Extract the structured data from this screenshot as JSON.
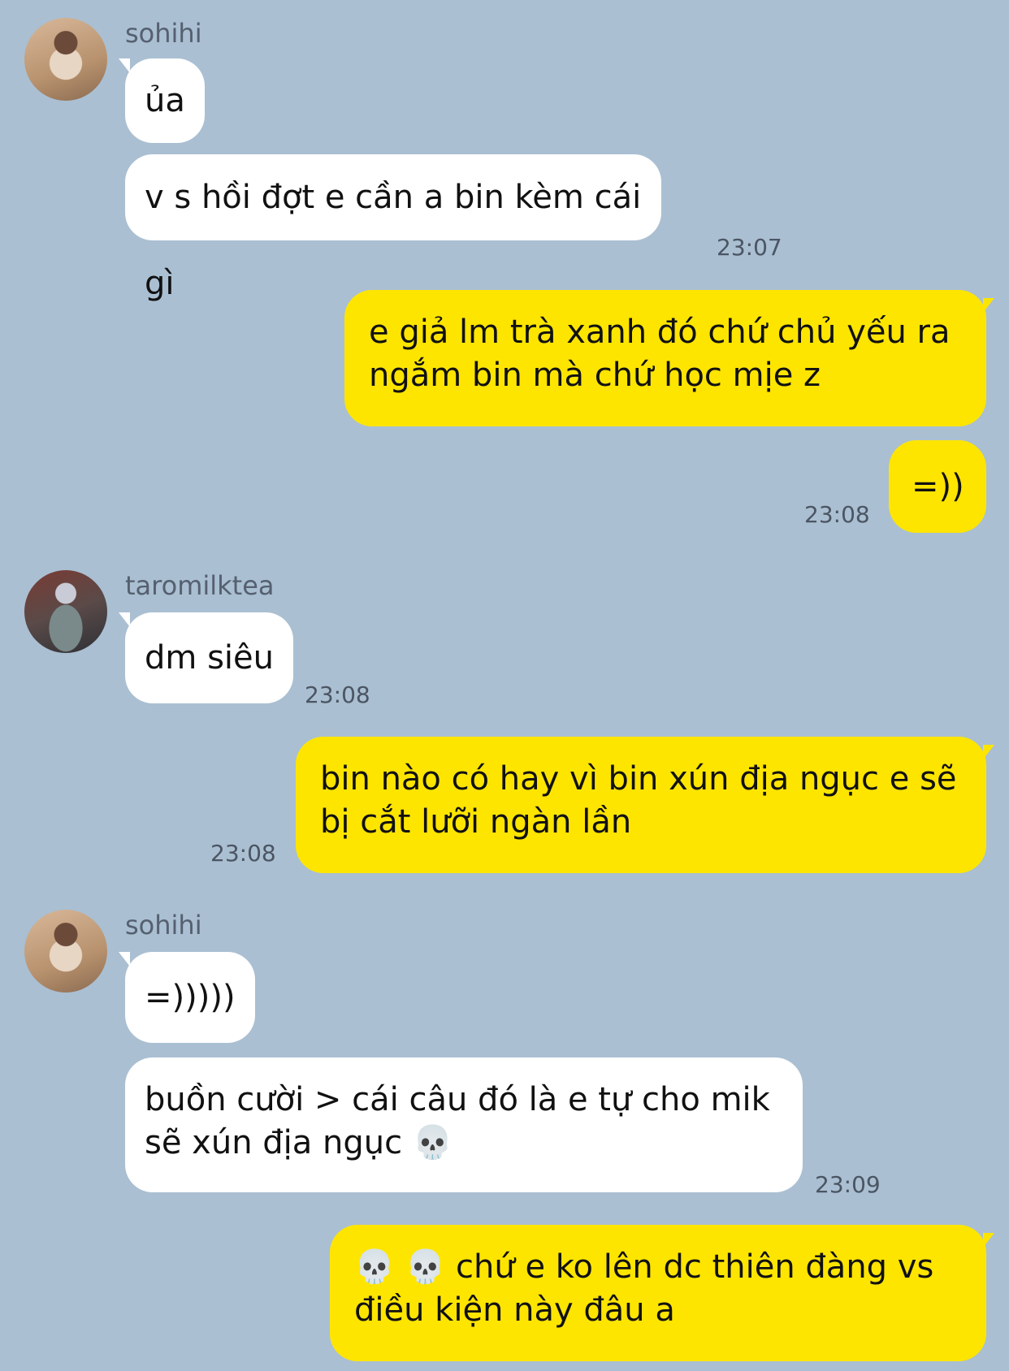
{
  "participants": {
    "sohihi": "sohihi",
    "taromilktea": "taromilktea"
  },
  "messages": {
    "m1": "ủa",
    "m2": "v s hồi đợt e cần a bin kèm cái gì",
    "m2_time": "23:07",
    "m3_line1": "e giả lm trà xanh đó chứ chủ yếu ra",
    "m3_line2": "ngắm bin mà chứ học mịe z",
    "m4": "=))",
    "m4_time": "23:08",
    "m5": "dm siêu",
    "m5_time": "23:08",
    "m6_line1": "bin nào có hay vì bin xún địa ngục e sẽ",
    "m6_line2": "bị cắt lưỡi ngàn lần",
    "m6_time": "23:08",
    "m7": "=)))))",
    "m8_line1": "buồn cười > cái câu đó là e tự cho mik",
    "m8_line2": "sẽ xún địa ngục",
    "m8_emoji": "💀",
    "m8_time": "23:09",
    "m9_emoji": "💀 💀",
    "m9_line1": "chứ e ko lên dc thiên đàng vs",
    "m9_line2": "điều kiện này đâu a"
  },
  "colors": {
    "background": "#aabfd2",
    "incoming_bubble": "#ffffff",
    "outgoing_bubble": "#fee500"
  },
  "icons": {
    "skull": "skull-emoji"
  }
}
